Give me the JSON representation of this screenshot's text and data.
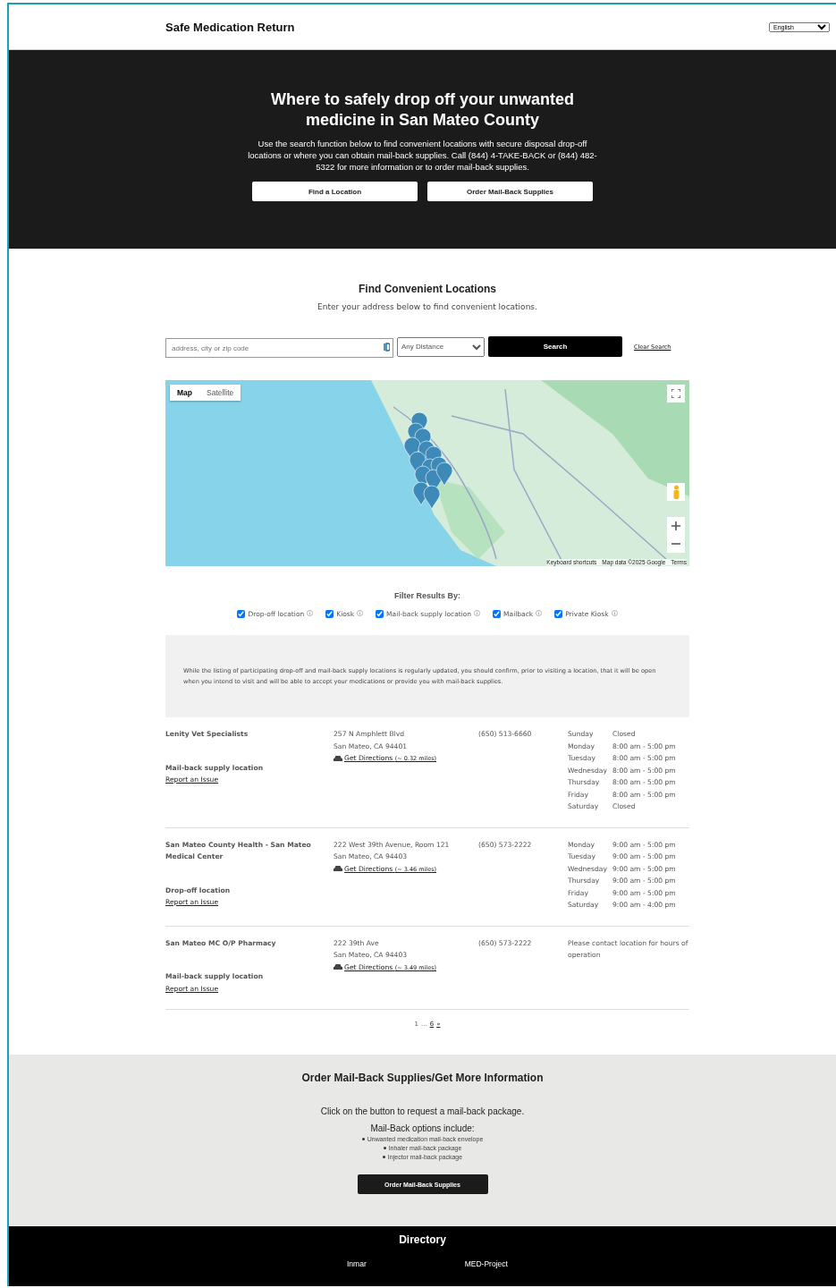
{
  "header": {
    "title": "Safe Medication Return",
    "language": "English"
  },
  "hero": {
    "title": "Where to safely drop off your unwanted medicine in San Mateo County",
    "text": "Use the search function below to find convenient locations with secure disposal drop-off locations or where you can obtain mail-back supplies. Call (844) 4-TAKE-BACK or (844) 482-5322 for more information or to order mail-back supplies.",
    "buttons": [
      "Find a Location",
      "Order Mail-Back Supplies"
    ]
  },
  "finder": {
    "title": "Find Convenient Locations",
    "subtitle": "Enter your address below to find convenient locations.",
    "search": {
      "placeholder": "address, city or zip code",
      "distance": "Any Distance",
      "button": "Search",
      "clear": "Clear Search"
    },
    "map": {
      "view_tabs": [
        {
          "label": "Map",
          "selected": true
        },
        {
          "label": "Satellite",
          "selected": false
        }
      ],
      "attribution": [
        "Keyboard shortcuts",
        "Map data ©2025 Google",
        "Terms"
      ]
    }
  },
  "filters": {
    "title": "Filter Results By:",
    "options": [
      {
        "label": "Drop-off location",
        "checked": true
      },
      {
        "label": "Kiosk",
        "checked": true
      },
      {
        "label": "Mail-back supply location",
        "checked": true
      },
      {
        "label": "Mailback",
        "checked": true
      },
      {
        "label": "Private Kiosk",
        "checked": true
      }
    ]
  },
  "disclaimer": "While the listing of participating drop-off and mail-back supply locations is regularly updated, you should confirm, prior to visiting a location, that it will be open when you intend to visit and will be able to accept your medications or provide you with mail-back supplies.",
  "locations": [
    {
      "name": "Lenity Vet Specialists",
      "type": "Mail-back supply location",
      "report": "Report an Issue",
      "address": [
        "257 N Amphlett Blvd",
        "San Mateo, CA 94401"
      ],
      "directions": "Get Directions",
      "distance": "(~ 0.32 miles)",
      "phone": "(650) 513-6660",
      "hours": [
        {
          "day": "Sunday",
          "time": "Closed"
        },
        {
          "day": "Monday",
          "time": "8:00 am - 5:00 pm"
        },
        {
          "day": "Tuesday",
          "time": "8:00 am - 5:00 pm"
        },
        {
          "day": "Wednesday",
          "time": "8:00 am - 5:00 pm"
        },
        {
          "day": "Thursday",
          "time": "8:00 am - 5:00 pm"
        },
        {
          "day": "Friday",
          "time": "8:00 am - 5:00 pm"
        },
        {
          "day": "Saturday",
          "time": "Closed"
        }
      ]
    },
    {
      "name": "San Mateo County Health - San Mateo Medical Center",
      "type": "Drop-off location",
      "report": "Report an Issue",
      "address": [
        "222 West 39th Avenue, Room 121",
        "San Mateo, CA 94403"
      ],
      "directions": "Get Directions",
      "distance": "(~ 3.46 miles)",
      "phone": "(650) 573-2222",
      "hours": [
        {
          "day": "Monday",
          "time": "9:00 am - 5:00 pm"
        },
        {
          "day": "Tuesday",
          "time": "9:00 am - 5:00 pm"
        },
        {
          "day": "Wednesday",
          "time": "9:00 am - 5:00 pm"
        },
        {
          "day": "Thursday",
          "time": "9:00 am - 5:00 pm"
        },
        {
          "day": "Friday",
          "time": "9:00 am - 5:00 pm"
        },
        {
          "day": "Saturday",
          "time": "9:00 am - 4:00 pm"
        }
      ]
    },
    {
      "name": "San Mateo MC O/P Pharmacy",
      "type": "Mail-back supply location",
      "report": "Report an Issue",
      "address": [
        "222 39th Ave",
        "San Mateo, CA 94403"
      ],
      "directions": "Get Directions",
      "distance": "(~ 3.49 miles)",
      "phone": "(650) 573-2222",
      "hours_note": "Please contact location for hours of operation"
    }
  ],
  "pagination": {
    "first": "1",
    "ellipsis": "...",
    "last": "6",
    "next": "»"
  },
  "order": {
    "title": "Order Mail-Back Supplies/Get More Information",
    "intro": "Click on the button to request a mail-back package.",
    "options_title": "Mail-Back options include:",
    "options": [
      "Unwanted medication mail-back envelope",
      "Inhaler mail-back package",
      "Injector mail-back package"
    ],
    "button": "Order Mail-Back Supplies"
  },
  "footer": {
    "title": "Directory",
    "links": [
      "Inmar",
      "MED-Project"
    ]
  }
}
